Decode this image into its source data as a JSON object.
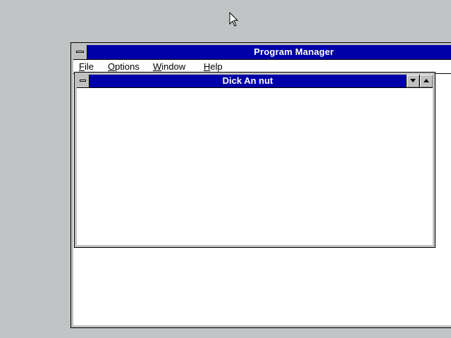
{
  "program_manager": {
    "title": "Program Manager",
    "menu": [
      {
        "mnemonic": "F",
        "rest": "ile"
      },
      {
        "mnemonic": "O",
        "rest": "ptions"
      },
      {
        "mnemonic": "W",
        "rest": "indow"
      },
      {
        "mnemonic": "H",
        "rest": "elp"
      }
    ]
  },
  "group_window": {
    "title": "Dick An nut"
  },
  "colors": {
    "title_active": "#0000a8",
    "desktop": "#c0c4c4",
    "frame": "#c0c0c0"
  },
  "icons": {
    "system_menu": "system-menu-icon",
    "minimize": "minimize-icon",
    "maximize": "maximize-icon",
    "cursor": "arrow-cursor-icon"
  }
}
